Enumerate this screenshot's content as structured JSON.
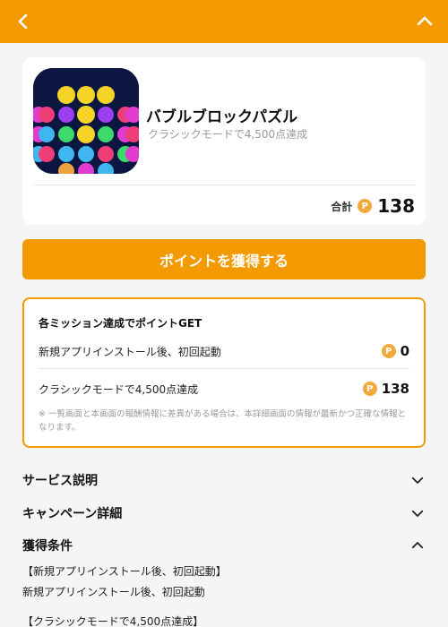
{
  "header": {
    "back_icon": "chevron-left-icon",
    "collapse_icon": "chevron-up-icon",
    "background": "#f29a00"
  },
  "app": {
    "name": "バブルブロックパズル",
    "subtitle": "クラシックモードで4,500点達成",
    "total_label": "合計",
    "total_points": "138",
    "coin_symbol": "P"
  },
  "cta": {
    "label": "ポイントを獲得する"
  },
  "missions": {
    "title": "各ミッション達成でポイントGET",
    "items": [
      {
        "label": "新規アプリインストール後、初回起動",
        "points": "0"
      },
      {
        "label": "クラシックモードで4,500点達成",
        "points": "138"
      }
    ],
    "note": "※ 一覧画面と本画面の報酬情報に差異がある場合は、本詳細画面の情報が最新かつ正確な情報となります。"
  },
  "sections": {
    "service": "サービス説明",
    "campaign": "キャンペーン詳細",
    "conditions": "獲得条件"
  },
  "conditions": {
    "heading1": "【新規アプリインストール後、初回起動】",
    "text1": "新規アプリインストール後、初回起動",
    "heading2": "【クラシックモードで4,500点達成】"
  },
  "colors": {
    "accent": "#f29a00",
    "coin": "#f2a93b",
    "muted": "#9a9a9a"
  }
}
